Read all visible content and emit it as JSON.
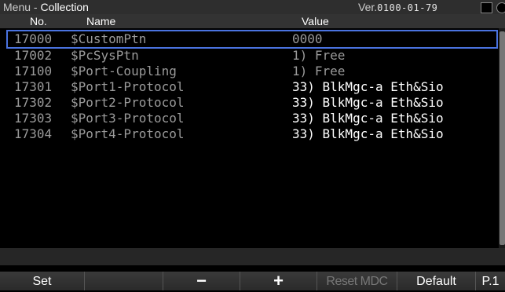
{
  "titlebar": {
    "menu_label": "Menu -",
    "title": "Collection",
    "ver_label": "Ver.",
    "ver_value": "0100-01-79"
  },
  "columns": {
    "no": "No.",
    "name": "Name",
    "value": "Value"
  },
  "rows": [
    {
      "no": "17000",
      "name": "$CustomPtn",
      "value": "0000"
    },
    {
      "no": "17002",
      "name": "$PcSysPtn",
      "value": "1) Free"
    },
    {
      "no": "17100",
      "name": "$Port-Coupling",
      "value": "1) Free"
    },
    {
      "no": "17301",
      "name": "$Port1-Protocol",
      "value": "33) BlkMgc-a Eth&Sio"
    },
    {
      "no": "17302",
      "name": "$Port2-Protocol",
      "value": "33) BlkMgc-a Eth&Sio"
    },
    {
      "no": "17303",
      "name": "$Port3-Protocol",
      "value": "33) BlkMgc-a Eth&Sio"
    },
    {
      "no": "17304",
      "name": "$Port4-Protocol",
      "value": "33) BlkMgc-a Eth&Sio"
    }
  ],
  "softkeys": {
    "set": "Set",
    "blank": "",
    "minus": "−",
    "plus": "+",
    "reset_mdc": "Reset MDC",
    "default": "Default",
    "page": "P.1"
  },
  "colors": {
    "selection_border": "#4a73e0",
    "background": "#000000",
    "titlebar": "#2e2e2e"
  }
}
